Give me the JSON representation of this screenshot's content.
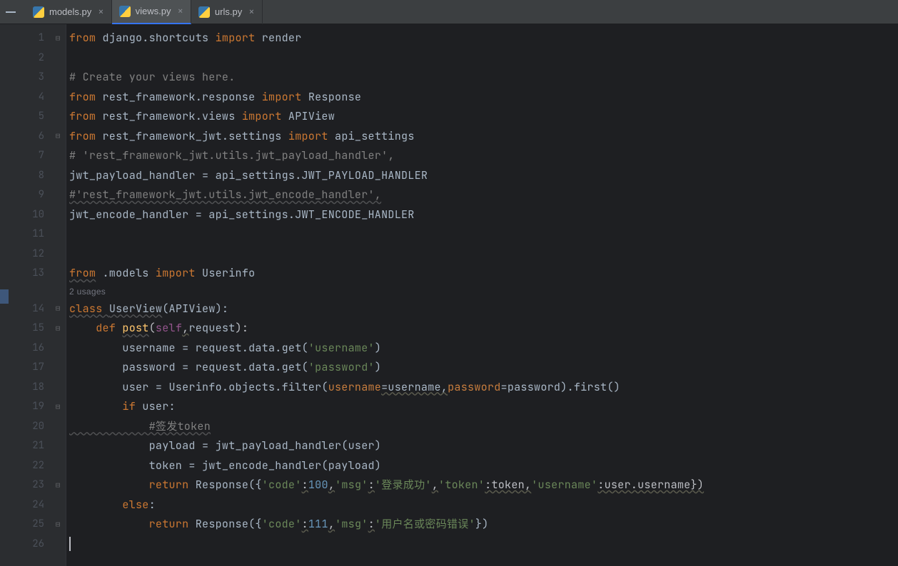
{
  "tabs": {
    "models": "models.py",
    "views": "views.py",
    "urls": "urls.py"
  },
  "usages": "2 usages",
  "code": {
    "l1a": "from",
    "l1b": " django.shortcuts ",
    "l1c": "import",
    "l1d": " render",
    "l3": "# Create your views here.",
    "l4a": "from",
    "l4b": " rest_framework.response ",
    "l4c": "import",
    "l4d": " Response",
    "l5a": "from",
    "l5b": " rest_framework.views ",
    "l5c": "import",
    "l5d": " APIView",
    "l6a": "from",
    "l6b": " rest_framework_jwt.settings ",
    "l6c": "import",
    "l6d": " api_settings",
    "l7": "# 'rest_framework_jwt.utils.jwt_payload_handler',",
    "l8": "jwt_payload_handler = api_settings.JWT_PAYLOAD_HANDLER",
    "l9": "#'rest_framework_jwt.utils.jwt_encode_handler',",
    "l10": "jwt_encode_handler = api_settings.JWT_ENCODE_HANDLER",
    "l13a": "from",
    "l13b": " .models ",
    "l13c": "import",
    "l13d": " Userinfo",
    "l14a": "class ",
    "l14b": "UserView",
    "l14c": "(APIView):",
    "l15a": "    ",
    "l15b": "def ",
    "l15c": "post",
    "l15d": "(",
    "l15e": "self",
    "l15f": ",",
    "l15g": "request",
    "l15h": "):",
    "l16a": "        username = request.data.get(",
    "l16b": "'username'",
    "l16c": ")",
    "l17a": "        password = request.data.get(",
    "l17b": "'password'",
    "l17c": ")",
    "l18a": "        user = Userinfo.objects.filter(",
    "l18b": "username",
    "l18c": "=username,",
    "l18d": "password",
    "l18e": "=password).first()",
    "l19a": "        ",
    "l19b": "if",
    "l19c": " user:",
    "l20": "            #签发token",
    "l21": "            payload = jwt_payload_handler(user)",
    "l22": "            token = jwt_encode_handler(payload)",
    "l23a": "            ",
    "l23b": "return",
    "l23c": " Response({",
    "l23d": "'code'",
    "l23e": ":",
    "l23f": "100",
    "l23g": ",",
    "l23h": "'msg'",
    "l23i": ":",
    "l23j": "'登录成功'",
    "l23k": ",",
    "l23l": "'token'",
    "l23m": ":token,",
    "l23n": "'username'",
    "l23o": ":user.username})",
    "l24a": "        ",
    "l24b": "else",
    "l24c": ":",
    "l25a": "            ",
    "l25b": "return",
    "l25c": " Response({",
    "l25d": "'code'",
    "l25e": ":",
    "l25f": "111",
    "l25g": ",",
    "l25h": "'msg'",
    "l25i": ":",
    "l25j": "'用户名或密码错误'",
    "l25k": "})"
  }
}
